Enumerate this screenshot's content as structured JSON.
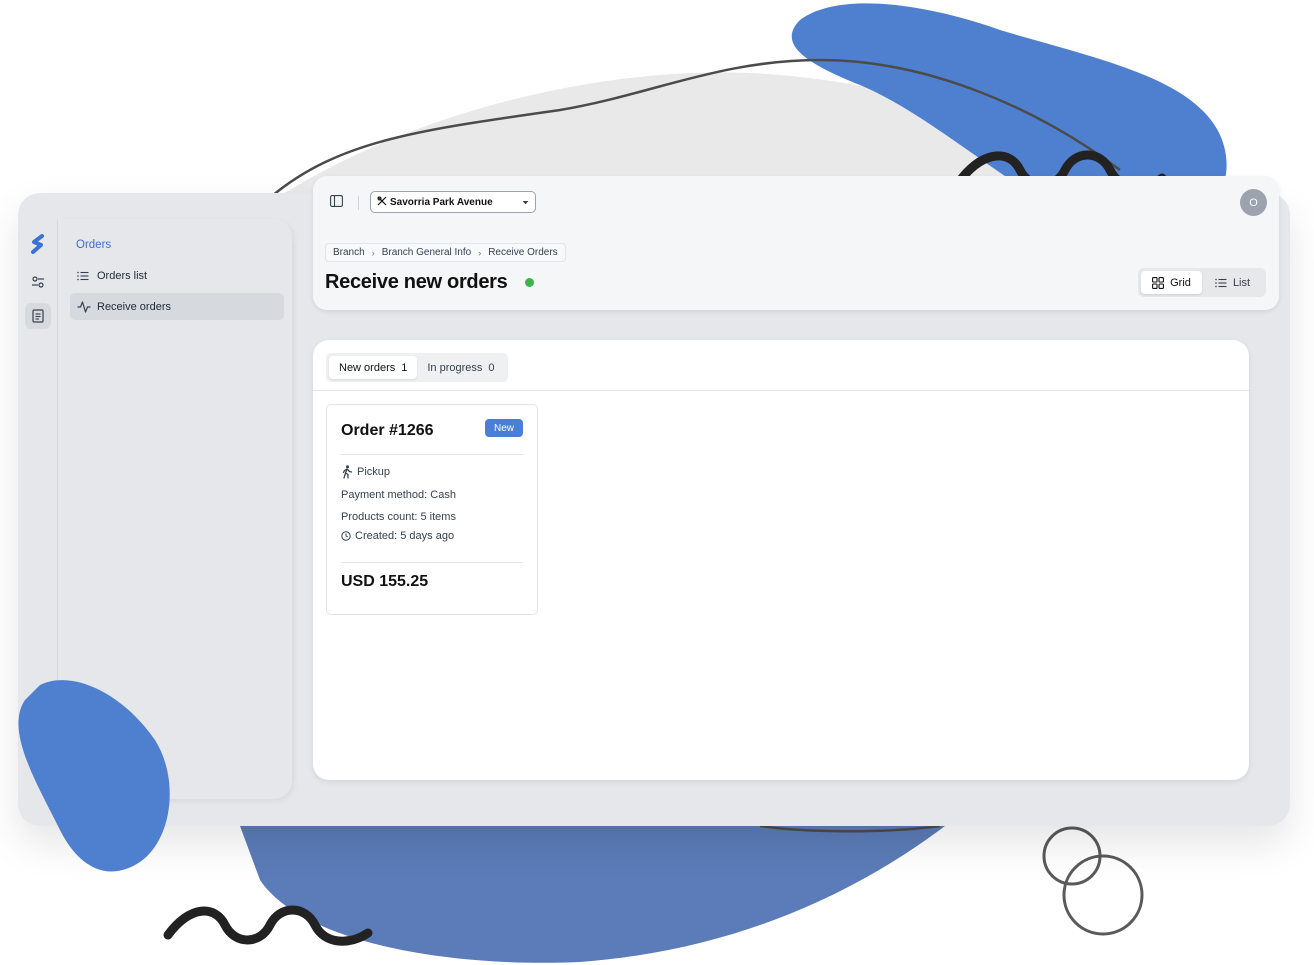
{
  "colors": {
    "accent": "#4a7fd8",
    "status_live": "#3bb54a",
    "shell_bg": "#e5e7eb",
    "blob_blue": "#4f7fd0"
  },
  "rail": {
    "items": [
      {
        "icon": "logo-icon"
      },
      {
        "icon": "sliders-icon"
      },
      {
        "icon": "receipt-icon"
      }
    ]
  },
  "sidebar": {
    "title": "Orders",
    "items": [
      {
        "label": "Orders list",
        "icon": "list-icon"
      },
      {
        "label": "Receive orders",
        "icon": "activity-icon"
      }
    ]
  },
  "header": {
    "branch_select": {
      "value": "Savorria Park Avenue",
      "icon": "utensils-icon"
    },
    "avatar_initial": "O",
    "breadcrumb": [
      "Branch",
      "Branch General Info",
      "Receive Orders"
    ],
    "title": "Receive new orders",
    "view_toggle": {
      "grid_label": "Grid",
      "list_label": "List",
      "selected": "Grid"
    }
  },
  "tabs": [
    {
      "label": "New orders",
      "count": "1"
    },
    {
      "label": "In progress",
      "count": "0"
    }
  ],
  "order": {
    "title": "Order #1266",
    "badge": "New",
    "type": "Pickup",
    "payment": "Payment method: Cash",
    "products": "Products count: 5 items",
    "created": "Created: 5 days ago",
    "total": "USD 155.25"
  }
}
